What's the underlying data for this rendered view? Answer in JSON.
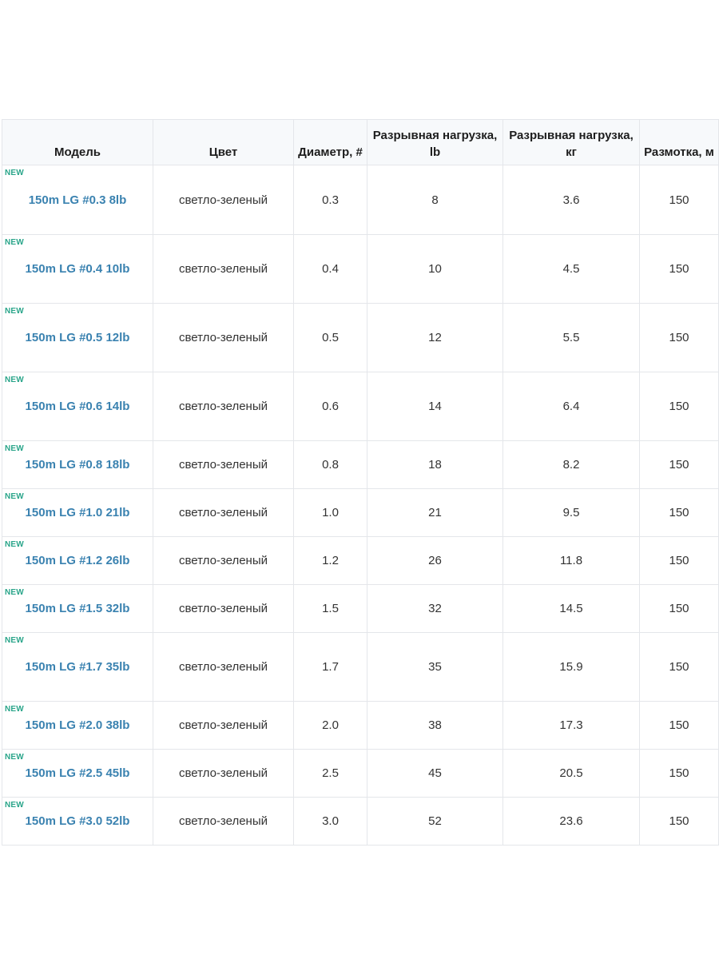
{
  "table": {
    "headers": {
      "model": "Модель",
      "color": "Цвет",
      "diameter": "Диаметр, #",
      "load_lb": "Разрывная нагрузка, lb",
      "load_kg": "Разрывная нагрузка, кг",
      "length": "Размотка, м"
    },
    "badge": "NEW",
    "rows": [
      {
        "model": "150m LG #0.3 8lb",
        "color": "светло-зеленый",
        "diameter": "0.3",
        "load_lb": "8",
        "load_kg": "3.6",
        "length": "150"
      },
      {
        "model": "150m LG #0.4 10lb",
        "color": "светло-зеленый",
        "diameter": "0.4",
        "load_lb": "10",
        "load_kg": "4.5",
        "length": "150"
      },
      {
        "model": "150m LG #0.5 12lb",
        "color": "светло-зеленый",
        "diameter": "0.5",
        "load_lb": "12",
        "load_kg": "5.5",
        "length": "150"
      },
      {
        "model": "150m LG #0.6 14lb",
        "color": "светло-зеленый",
        "diameter": "0.6",
        "load_lb": "14",
        "load_kg": "6.4",
        "length": "150"
      },
      {
        "model": "150m LG #0.8 18lb",
        "color": "светло-зеленый",
        "diameter": "0.8",
        "load_lb": "18",
        "load_kg": "8.2",
        "length": "150"
      },
      {
        "model": "150m LG #1.0 21lb",
        "color": "светло-зеленый",
        "diameter": "1.0",
        "load_lb": "21",
        "load_kg": "9.5",
        "length": "150"
      },
      {
        "model": "150m LG #1.2 26lb",
        "color": "светло-зеленый",
        "diameter": "1.2",
        "load_lb": "26",
        "load_kg": "11.8",
        "length": "150"
      },
      {
        "model": "150m LG #1.5 32lb",
        "color": "светло-зеленый",
        "diameter": "1.5",
        "load_lb": "32",
        "load_kg": "14.5",
        "length": "150"
      },
      {
        "model": "150m LG #1.7 35lb",
        "color": "светло-зеленый",
        "diameter": "1.7",
        "load_lb": "35",
        "load_kg": "15.9",
        "length": "150"
      },
      {
        "model": "150m LG #2.0 38lb",
        "color": "светло-зеленый",
        "diameter": "2.0",
        "load_lb": "38",
        "load_kg": "17.3",
        "length": "150"
      },
      {
        "model": "150m LG #2.5 45lb",
        "color": "светло-зеленый",
        "diameter": "2.5",
        "load_lb": "45",
        "load_kg": "20.5",
        "length": "150"
      },
      {
        "model": "150m LG #3.0 52lb",
        "color": "светло-зеленый",
        "diameter": "3.0",
        "load_lb": "52",
        "load_kg": "23.6",
        "length": "150"
      }
    ]
  },
  "colors": {
    "link": "#3a82b0",
    "badge": "#2aa58a",
    "header_bg": "#f7f9fb",
    "border": "#e4e6ea"
  }
}
